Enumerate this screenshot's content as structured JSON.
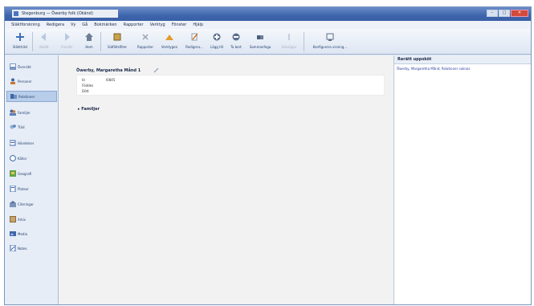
{
  "window": {
    "title": "Stegenburg — Öwerby folk (Okänd)",
    "buttons": {
      "minimize": "–",
      "maximize": "□",
      "close": "✕"
    }
  },
  "menubar": [
    "Släktforskning",
    "Redigera",
    "Vy",
    "Gå",
    "Bokmärken",
    "Rapporter",
    "Verktyg",
    "Fönster",
    "Hjälp"
  ],
  "toolbar": [
    {
      "label": "Släktträd",
      "icon": "tree-icon",
      "disabled": false
    },
    {
      "label": "Bakåt",
      "icon": "back-arrow-icon",
      "disabled": true
    },
    {
      "label": "Framåt",
      "icon": "forward-arrow-icon",
      "disabled": true
    },
    {
      "label": "Hem",
      "icon": "home-icon",
      "disabled": false
    },
    {
      "label": "Sidfältsfilter",
      "icon": "sidebar-filter-icon",
      "disabled": false
    },
    {
      "label": "Rapporter",
      "icon": "reports-icon",
      "disabled": false
    },
    {
      "label": "Verktygen",
      "icon": "tools-icon",
      "disabled": false
    },
    {
      "label": "Redigera…",
      "icon": "edit-icon",
      "disabled": false
    },
    {
      "label": "Lägg till",
      "icon": "add-icon",
      "disabled": false
    },
    {
      "label": "Ta bort",
      "icon": "remove-icon",
      "disabled": false
    },
    {
      "label": "Sammanfoga",
      "icon": "merge-icon",
      "disabled": false
    },
    {
      "label": "Sökvägar",
      "icon": "path-icon",
      "disabled": true
    },
    {
      "label": "Konfigurera visning…",
      "icon": "configure-view-icon",
      "disabled": false
    }
  ],
  "sidebar": {
    "active_index": 2,
    "items": [
      {
        "label": "Översikt",
        "icon": "dashboard-icon"
      },
      {
        "label": "Personer",
        "icon": "people-icon"
      },
      {
        "label": "Relationer",
        "icon": "relationships-icon"
      },
      {
        "label": "Familjer",
        "icon": "families-icon"
      },
      {
        "label": "Träd",
        "icon": "tree-chart-icon"
      },
      {
        "label": "Händelser",
        "icon": "events-icon"
      },
      {
        "label": "Källor",
        "icon": "sources-icon"
      },
      {
        "label": "Geografi",
        "icon": "geography-icon"
      },
      {
        "label": "Platser",
        "icon": "places-icon"
      },
      {
        "label": "Citeringar",
        "icon": "citations-icon"
      },
      {
        "label": "Arkiv",
        "icon": "repositories-icon"
      },
      {
        "label": "Media",
        "icon": "media-icon"
      },
      {
        "label": "Notes",
        "icon": "notes-icon"
      }
    ]
  },
  "main": {
    "person_title": "Öwerby, Margaretha Månd 1",
    "details": [
      {
        "label": "Id",
        "value": "I0845"
      },
      {
        "label": "Föddes",
        "value": ""
      },
      {
        "label": "Dött",
        "value": ""
      }
    ],
    "section_title": "Familjer"
  },
  "right_pane": {
    "header": "Rerätt uppsköt",
    "link": "Öwerby, Margaretha Månd; Relationer saknas"
  },
  "colors": {
    "titlebar": "#3e64ab",
    "link": "#2c3f9e",
    "active_nav": "#b8cdea"
  }
}
